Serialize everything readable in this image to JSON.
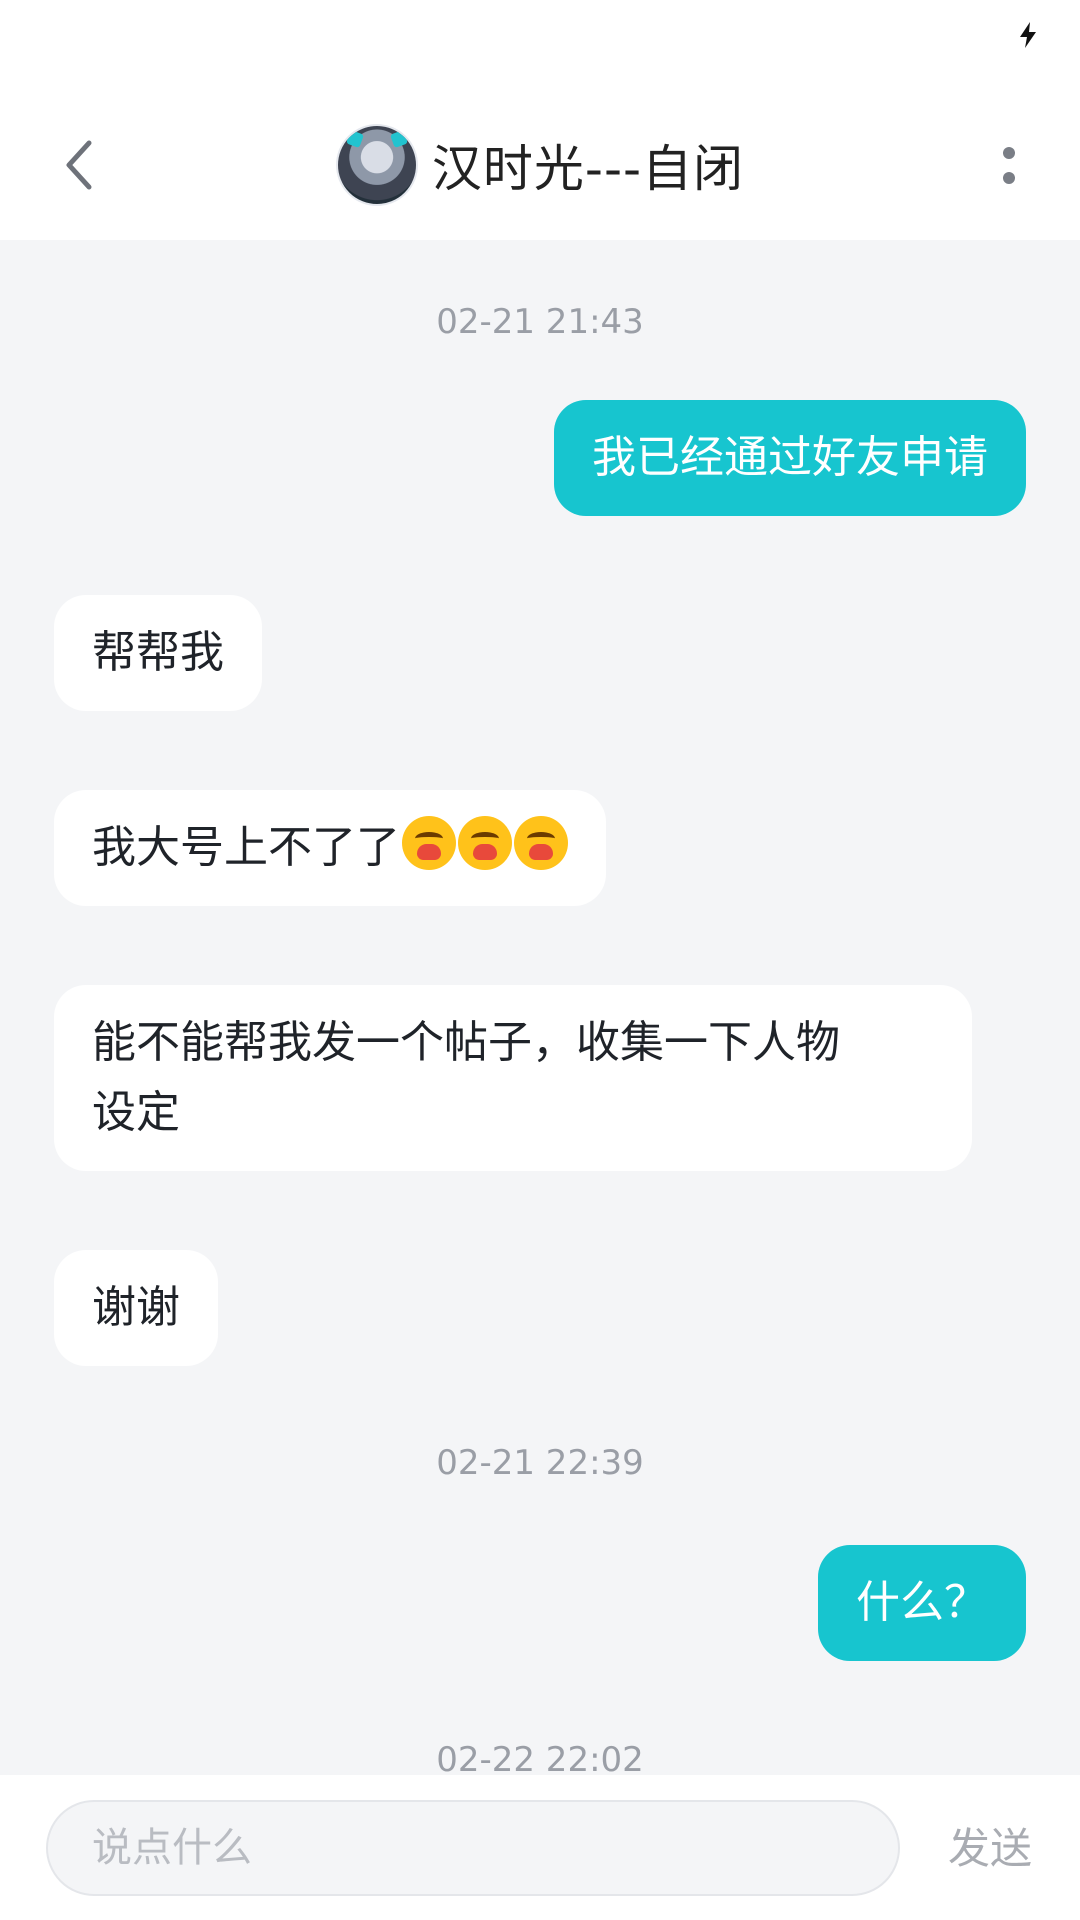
{
  "header": {
    "title": "汉时光---自闭"
  },
  "messages": {
    "timestamps": [
      "02-21 21:43",
      "02-21 22:39",
      "02-22 22:02"
    ],
    "items": [
      {
        "side": "out",
        "text": "我已经通过好友申请"
      },
      {
        "side": "in",
        "text": "帮帮我"
      },
      {
        "side": "in",
        "text": "我大号上不了了",
        "emoji": [
          "crying-emoji",
          "crying-emoji",
          "crying-emoji"
        ]
      },
      {
        "side": "in",
        "text_line1": "能不能帮我发一个帖子，收集一下人物",
        "text_line2": "设定"
      },
      {
        "side": "in",
        "text": "谢谢"
      },
      {
        "side": "out",
        "text": "什么？"
      }
    ]
  },
  "input": {
    "placeholder": "说点什么",
    "send_label": "发送"
  },
  "colors": {
    "outgoing_bubble": "#17c5cf",
    "background": "#f4f5f7"
  }
}
